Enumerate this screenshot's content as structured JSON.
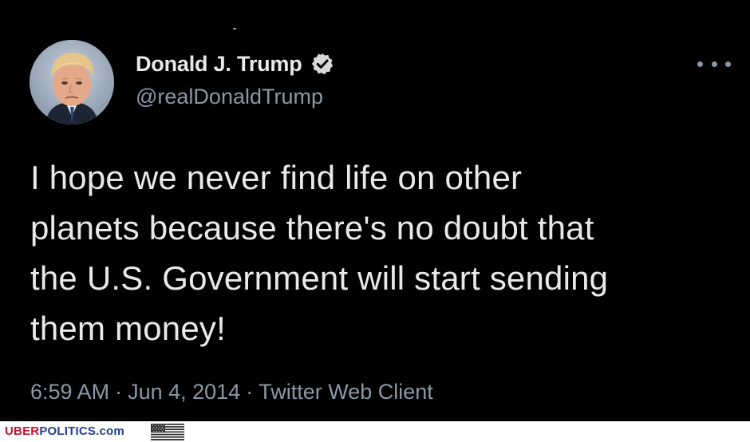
{
  "tweet": {
    "display_name": "Donald J. Trump",
    "handle": "@realDonaldTrump",
    "verified": true,
    "text_lines": [
      "I hope we never find life on other",
      "planets because there's no doubt that",
      "the U.S. Government will start sending",
      "them money!"
    ],
    "time": "6:59 AM",
    "date": "Jun 4, 2014",
    "client": "Twitter Web Client",
    "separator": "·"
  },
  "icons": {
    "verified": "verified-badge-icon",
    "more": "more-options-icon",
    "flag": "us-flag-icon"
  },
  "colors": {
    "background": "#000000",
    "primary_text": "#e7e9ea",
    "secondary_text": "#8b98a5",
    "watermark_red": "#c8102e",
    "watermark_blue": "#1f3f8f"
  },
  "watermark": {
    "part1": "UBER",
    "part2": "POLITICS",
    "part3": ".com"
  }
}
